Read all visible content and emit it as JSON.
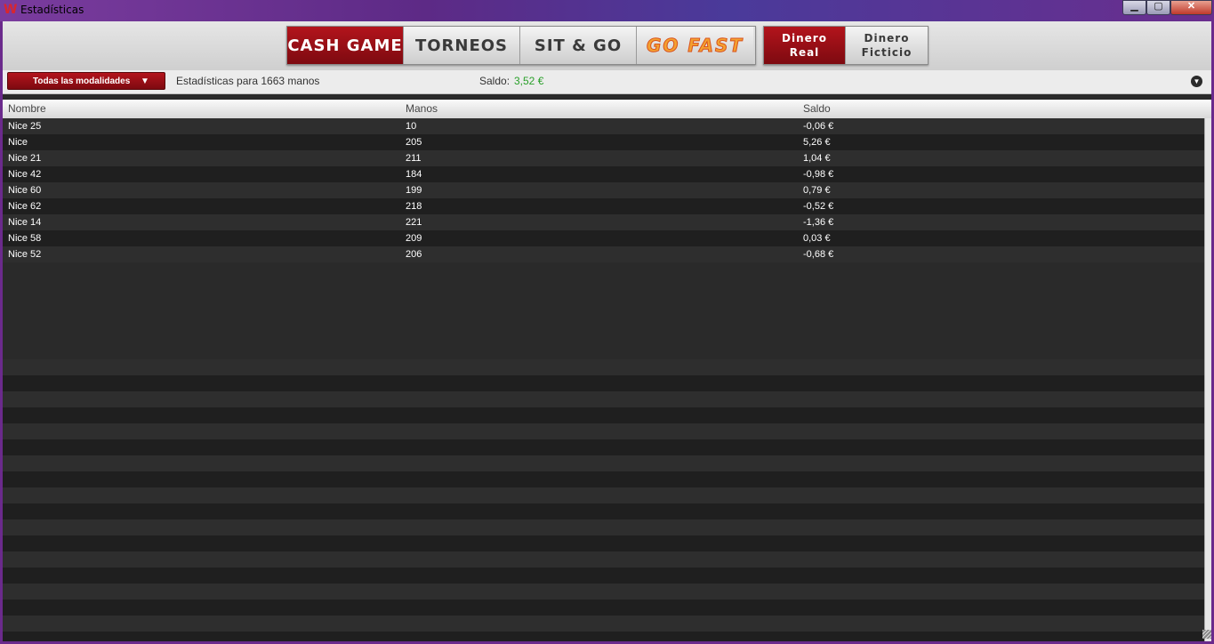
{
  "window": {
    "title": "Estadísticas",
    "logo_glyph": "W",
    "controls": {
      "minimize": "▁",
      "maximize": "▢",
      "close": "✕"
    }
  },
  "nav": {
    "game_tabs": [
      {
        "label": "CASH GAME",
        "active": true
      },
      {
        "label": "TORNEOS",
        "active": false
      },
      {
        "label": "SIT & GO",
        "active": false
      },
      {
        "label": "GO FAST",
        "active": false
      }
    ],
    "money_tabs": [
      {
        "line1": "Dinero",
        "line2": "Real",
        "active": true
      },
      {
        "line1": "Dinero",
        "line2": "Ficticio",
        "active": false
      }
    ]
  },
  "filter": {
    "mode_label": "Todas las modalidades",
    "stats_text": "Estadísticas para 1663 manos",
    "saldo_label": "Saldo:",
    "saldo_value": "3,52 €",
    "saldo_color": "#2aa02a",
    "collapse_icon": "▼"
  },
  "table": {
    "columns": [
      "Nombre",
      "Manos",
      "Saldo"
    ],
    "rows": [
      [
        "Nice 25",
        "10",
        "-0,06 €"
      ],
      [
        "Nice",
        "205",
        "5,26 €"
      ],
      [
        "Nice 21",
        "211",
        "1,04 €"
      ],
      [
        "Nice 42",
        "184",
        "-0,98 €"
      ],
      [
        "Nice 60",
        "199",
        "0,79 €"
      ],
      [
        "Nice 62",
        "218",
        "-0,52 €"
      ],
      [
        "Nice 14",
        "221",
        "-1,36 €"
      ],
      [
        "Nice 58",
        "209",
        "0,03 €"
      ],
      [
        "Nice 52",
        "206",
        "-0,68 €"
      ]
    ]
  },
  "colors": {
    "accent_red": "#b3141c",
    "row_odd": "#2e2e2e",
    "row_even": "#1f1f1f"
  }
}
